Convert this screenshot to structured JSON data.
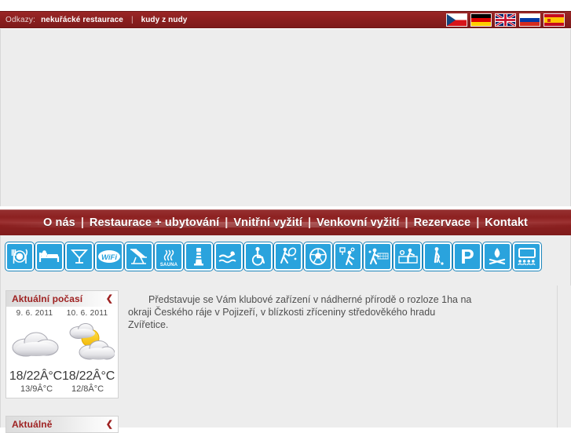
{
  "topbar": {
    "label": "Odkazy:",
    "links": [
      {
        "text": "nekuřácké restaurace"
      },
      {
        "text": "kudy z nudy"
      }
    ],
    "separator": "|",
    "background": "#8a1f1f"
  },
  "languages": [
    {
      "name": "flag-czech",
      "title": "Česky"
    },
    {
      "name": "flag-german",
      "title": "Deutsch"
    },
    {
      "name": "flag-english",
      "title": "English"
    },
    {
      "name": "flag-russian",
      "title": "Русский"
    },
    {
      "name": "flag-spanish",
      "title": "Español"
    }
  ],
  "nav": {
    "separator": "|",
    "items": [
      {
        "label": "O nás"
      },
      {
        "label": "Restaurace + ubytování"
      },
      {
        "label": "Vnitřní vyžití"
      },
      {
        "label": "Venkovní vyžití"
      },
      {
        "label": "Rezervace"
      },
      {
        "label": "Kontakt"
      }
    ],
    "background": "#8d2020"
  },
  "amenities": [
    {
      "icon": "restaurant-icon",
      "label": "Restaurace"
    },
    {
      "icon": "bed-icon",
      "label": "Ubytování"
    },
    {
      "icon": "cocktail-icon",
      "label": "Bar"
    },
    {
      "icon": "wifi-icon",
      "label": "WiFi",
      "text": "WiFi"
    },
    {
      "icon": "deckchair-icon",
      "label": "Relaxace"
    },
    {
      "icon": "sauna-icon",
      "label": "Sauna",
      "text": "SAUNA"
    },
    {
      "icon": "lighthouse-icon",
      "label": "Rozhledna"
    },
    {
      "icon": "swimming-icon",
      "label": "Plavání"
    },
    {
      "icon": "wheelchair-icon",
      "label": "Bezbariérový přístup"
    },
    {
      "icon": "tennis-icon",
      "label": "Tenis"
    },
    {
      "icon": "football-icon",
      "label": "Fotbal"
    },
    {
      "icon": "basketball-icon",
      "label": "Basketbal"
    },
    {
      "icon": "volleyball-icon",
      "label": "Volejbal"
    },
    {
      "icon": "tabletennis-icon",
      "label": "Stolní tenis"
    },
    {
      "icon": "golf-icon",
      "label": "Golf"
    },
    {
      "icon": "parking-icon",
      "label": "Parkování",
      "text": "P"
    },
    {
      "icon": "campfire-icon",
      "label": "Ohniště"
    },
    {
      "icon": "conference-icon",
      "label": "Konference"
    }
  ],
  "weather": {
    "title": "Aktuální počasí",
    "toggle": "❮",
    "days": [
      {
        "date": "9. 6. 2011",
        "icon": "cloudy-icon",
        "temp_day": "18/22Â°C",
        "temp_night": "13/9Â°C"
      },
      {
        "date": "10. 6. 2011",
        "icon": "partly-sunny-icon",
        "temp_day": "18/22Â°C",
        "temp_night": "12/8Â°C"
      }
    ]
  },
  "news": {
    "title": "Aktuálně",
    "toggle": "❮"
  },
  "article": {
    "paragraph": "Představuje se Vám klubové zařízení v nádherné přírodě o rozloze 1ha na okraji Českého ráje v Pojizeří, v blízkosti zříceniny středověkého hradu Zvířetice."
  }
}
